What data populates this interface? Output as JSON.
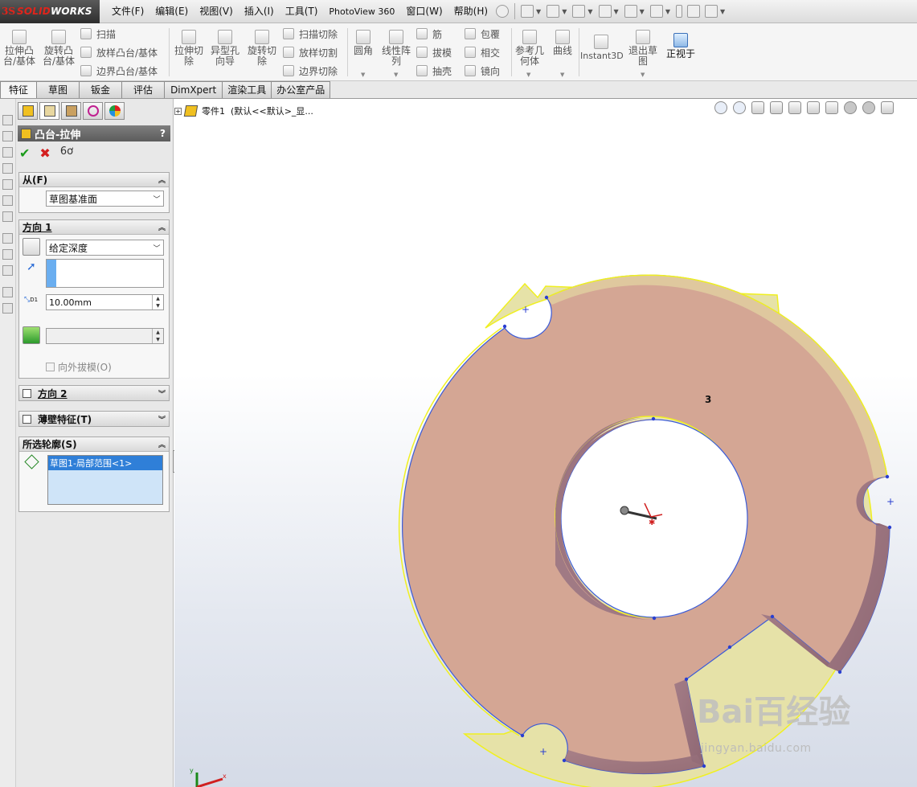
{
  "app": {
    "logo_prefix": "3S",
    "logo_name": "SOLID",
    "logo_name_bold": "WORKS"
  },
  "menu": {
    "items": [
      "文件(F)",
      "编辑(E)",
      "视图(V)",
      "插入(I)",
      "工具(T)",
      "PhotoView 360",
      "窗口(W)",
      "帮助(H)"
    ]
  },
  "ribbon": {
    "extrude_boss": "拉伸凸\n台/基体",
    "revolve_boss": "旋转凸\n台/基体",
    "sweep": "扫描",
    "loft_boss": "放样凸台/基体",
    "boundary_boss": "边界凸台/基体",
    "extrude_cut": "拉伸切\n除",
    "hole_wizard": "异型孔\n向导",
    "revolve_cut": "旋转切\n除",
    "sweep_cut": "扫描切除",
    "loft_cut": "放样切割",
    "boundary_cut": "边界切除",
    "fillet": "圆角",
    "linear_pattern": "线性阵\n列",
    "rib": "筋",
    "draft": "拔模",
    "shell": "抽壳",
    "wrap": "包覆",
    "intersect": "相交",
    "mirror": "镜向",
    "ref_geometry": "参考几\n何体",
    "curves": "曲线",
    "instant3d": "Instant3D",
    "exit_sketch": "退出草\n图",
    "normal_to": "正视于"
  },
  "tabs": [
    "特征",
    "草图",
    "钣金",
    "评估",
    "DimXpert",
    "渲染工具",
    "办公室产品"
  ],
  "property_manager": {
    "title": "凸台-拉伸",
    "help": "?",
    "from": {
      "label": "从(F)",
      "value": "草图基准面"
    },
    "direction1": {
      "label": "方向 1",
      "end_condition": "给定深度",
      "depth": "10.00mm",
      "depth_symbol": "D1",
      "draft_outward": "向外拔模(O)"
    },
    "direction2": {
      "label": "方向 2"
    },
    "thin_feature": {
      "label": "薄壁特征(T)"
    },
    "selected_contours": {
      "label": "所选轮廓(S)",
      "items": [
        "草图1-局部范围<1>"
      ]
    }
  },
  "tree": {
    "part": "零件1  (默认<<默认>_显..."
  },
  "viewport": {
    "dimension_label": "3",
    "triad_x": "x",
    "triad_y": "y"
  },
  "watermark": {
    "main": "Bai百经验",
    "sub": "jingyan.baidu.com"
  },
  "colors": {
    "face": "#d4a694",
    "wall": "#9d7580",
    "highlight": "#f0f020",
    "edge_blue": "#3a5bd8",
    "title_bar": "#6b6b6b",
    "select_blue": "#2f7fd8"
  }
}
